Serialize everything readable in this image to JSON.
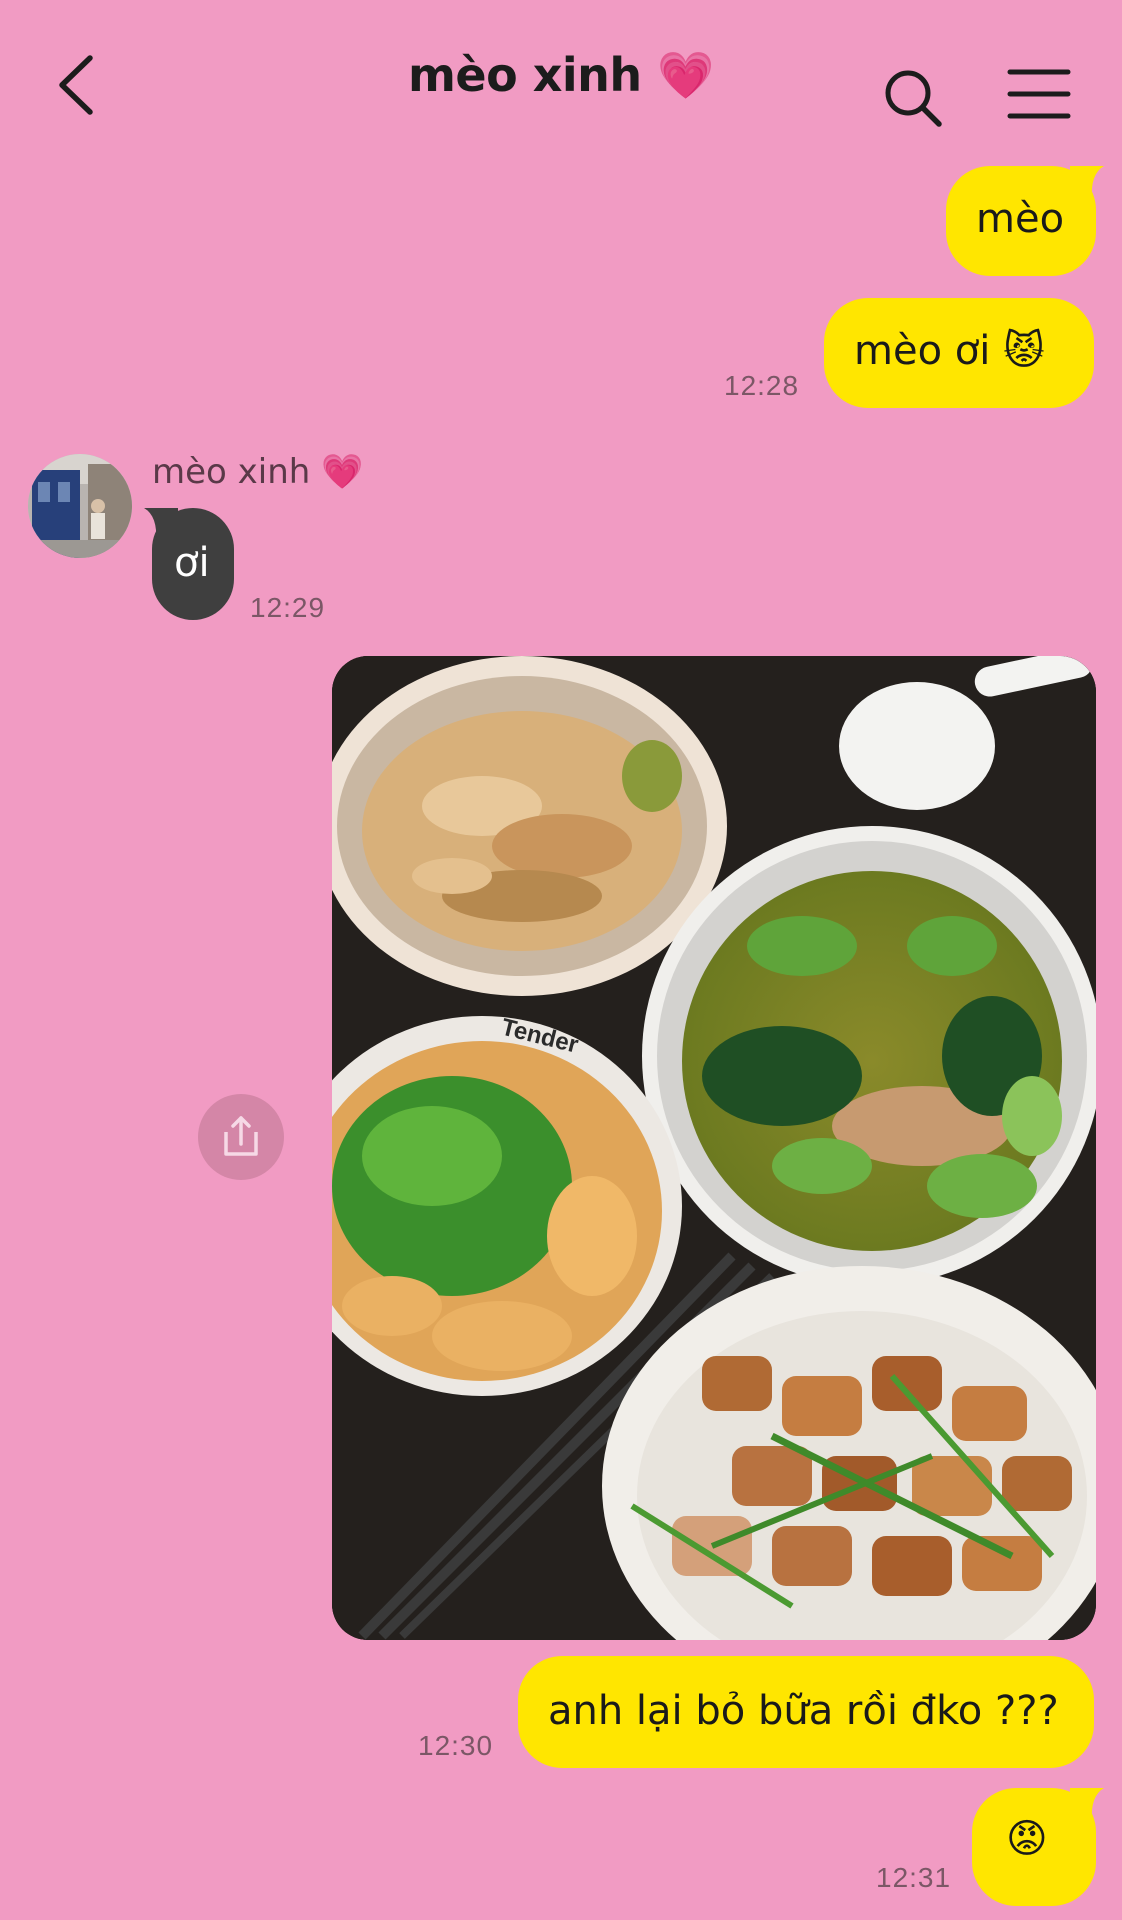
{
  "header": {
    "title": "mèo xinh 💗",
    "back_icon": "chevron-left-icon",
    "search_icon": "search-icon",
    "menu_icon": "hamburger-menu-icon"
  },
  "colors": {
    "background": "#f19bc3",
    "outgoing_bubble": "#ffe600",
    "incoming_bubble": "#3f3f3f"
  },
  "messages": [
    {
      "direction": "out",
      "text": "mèo"
    },
    {
      "direction": "out",
      "text": "mèo ơi 😾",
      "time": "12:28"
    },
    {
      "direction": "in",
      "sender": "mèo xinh 💗",
      "text": "ơi",
      "time": "12:29"
    },
    {
      "direction": "out",
      "type": "image",
      "alt": "photo"
    },
    {
      "direction": "out",
      "text": "anh lại bỏ bữa rồi đko ???",
      "time": "12:30"
    },
    {
      "direction": "out",
      "text": "😡",
      "time": "12:31"
    }
  ],
  "share_icon": "share-icon",
  "image_text": {
    "bowl_label": "Tender"
  }
}
